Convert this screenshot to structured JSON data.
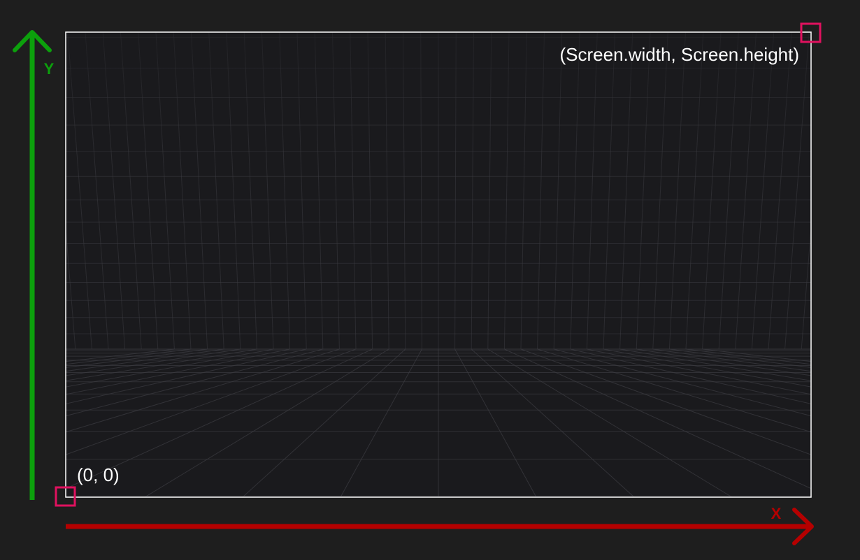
{
  "labels": {
    "top_right_corner": "(Screen.width, Screen.height)",
    "bottom_left_corner": "(0, 0)",
    "x_axis": "X",
    "y_axis": "Y"
  },
  "colors": {
    "background": "#1e1e1e",
    "screen_fill": "#1a1a1d",
    "screen_border": "#ffffff",
    "grid_line": "#3b3b40",
    "x_axis": "#b50000",
    "y_axis": "#0ca00c",
    "corner_marker": "#e0115f",
    "label_text": "#ffffff"
  }
}
